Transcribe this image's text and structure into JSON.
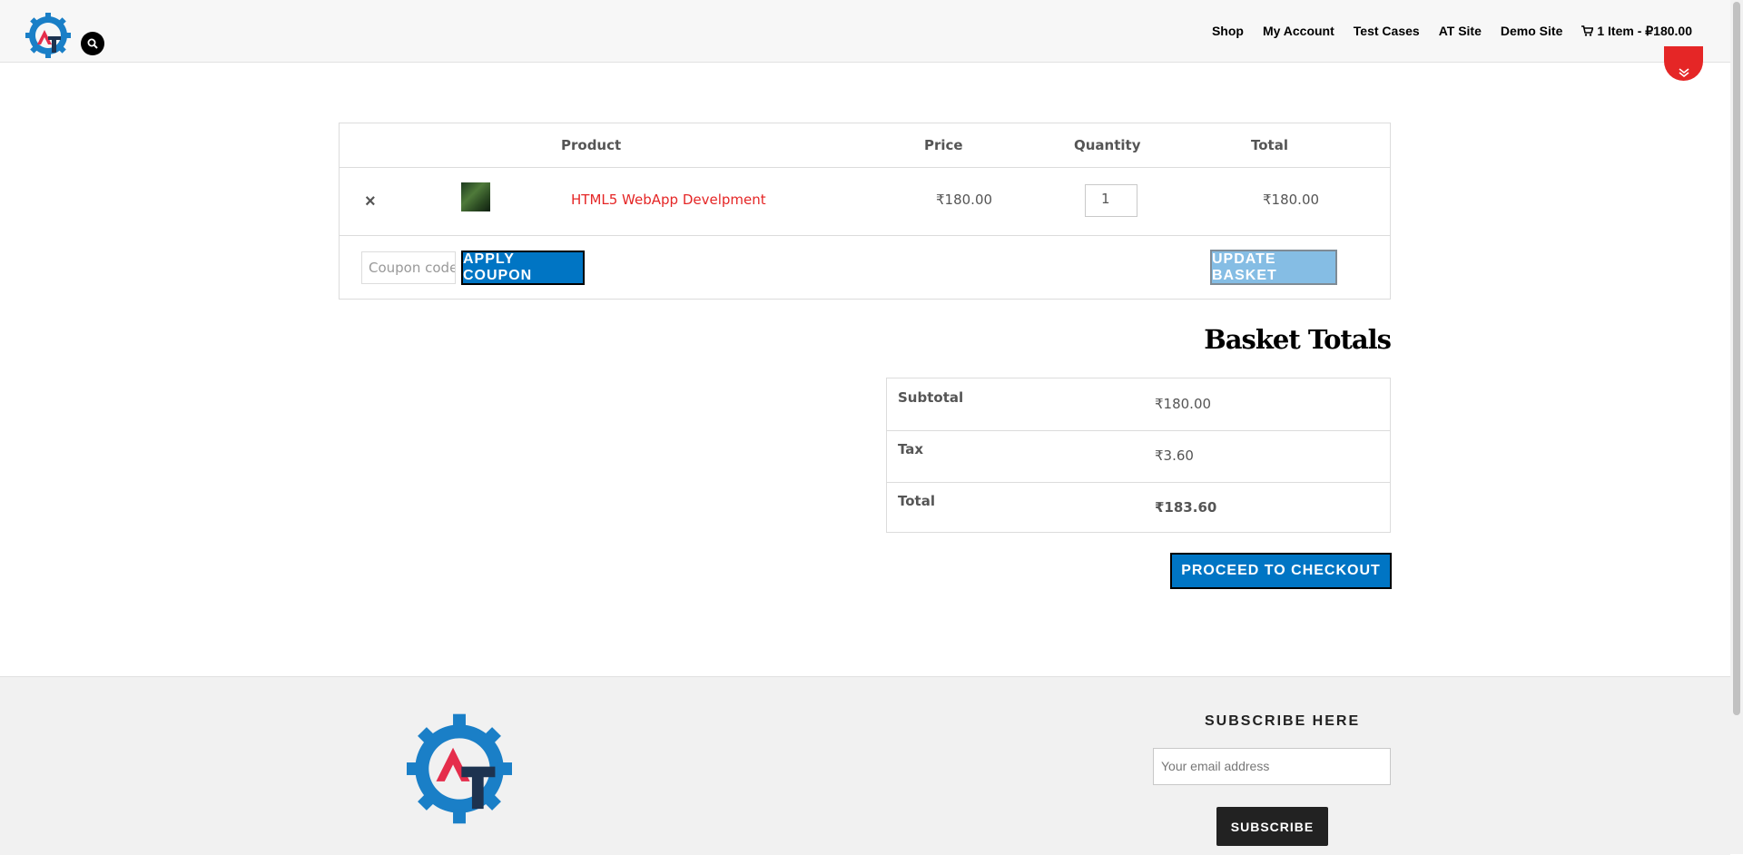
{
  "header": {
    "nav": [
      "Shop",
      "My Account",
      "Test Cases",
      "AT Site",
      "Demo Site"
    ],
    "cart_summary": "1 Item - ₽180.00"
  },
  "cart": {
    "columns": {
      "product": "Product",
      "price": "Price",
      "quantity": "Quantity",
      "total": "Total"
    },
    "item": {
      "remove": "×",
      "name": "HTML5 WebApp Develpment",
      "price": "₹180.00",
      "quantity": "1",
      "total": "₹180.00"
    },
    "coupon_placeholder": "Coupon code",
    "apply_coupon": "APPLY COUPON",
    "update_basket": "UPDATE BASKET"
  },
  "totals": {
    "title": "Basket Totals",
    "subtotal_label": "Subtotal",
    "subtotal_value": "₹180.00",
    "tax_label": "Tax",
    "tax_value": "₹3.60",
    "total_label": "Total",
    "total_value": "₹183.60",
    "checkout": "PROCEED TO CHECKOUT"
  },
  "footer": {
    "subscribe_title": "SUBSCRIBE HERE",
    "email_placeholder": "Your email address",
    "subscribe_button": "SUBSCRIBE"
  },
  "colors": {
    "accent_red": "#e52626",
    "button_blue": "#0075c4",
    "update_blue": "#85bde4",
    "logo_blue": "#1a7fc7",
    "logo_navy": "#1d3350"
  }
}
